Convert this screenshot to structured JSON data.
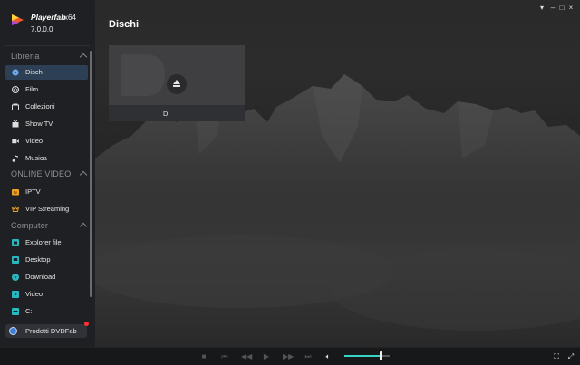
{
  "app": {
    "name": "Playerfab",
    "arch": "x64",
    "version": "7.0.0.0"
  },
  "sidebar": {
    "sections": [
      {
        "label": "Libreria",
        "items": [
          {
            "label": "Dischi",
            "icon": "disc-icon",
            "active": true
          },
          {
            "label": "Film",
            "icon": "film-reel-icon"
          },
          {
            "label": "Collezioni",
            "icon": "collection-icon"
          },
          {
            "label": "Show TV",
            "icon": "tv-icon"
          },
          {
            "label": "Video",
            "icon": "video-camera-icon"
          },
          {
            "label": "Musica",
            "icon": "music-note-icon"
          }
        ]
      },
      {
        "label": "ONLINE VIDEO",
        "items": [
          {
            "label": "IPTV",
            "icon": "iptv-icon"
          },
          {
            "label": "VIP Streaming",
            "icon": "crown-icon"
          }
        ]
      },
      {
        "label": "Computer",
        "items": [
          {
            "label": "Explorer file",
            "icon": "file-explorer-icon"
          },
          {
            "label": "Desktop",
            "icon": "desktop-icon"
          },
          {
            "label": "Download",
            "icon": "download-icon"
          },
          {
            "label": "Video",
            "icon": "video-folder-icon"
          },
          {
            "label": "C:",
            "icon": "drive-icon"
          }
        ]
      }
    ],
    "dvdfab_button": "Prodotti DVDFab"
  },
  "main": {
    "title": "Dischi",
    "disc": {
      "label": "D:"
    }
  },
  "player": {
    "volume_percent": 80
  },
  "colors": {
    "accent": "#37d3c4",
    "active_nav": "#2c3f55",
    "notification": "#ff3333"
  }
}
